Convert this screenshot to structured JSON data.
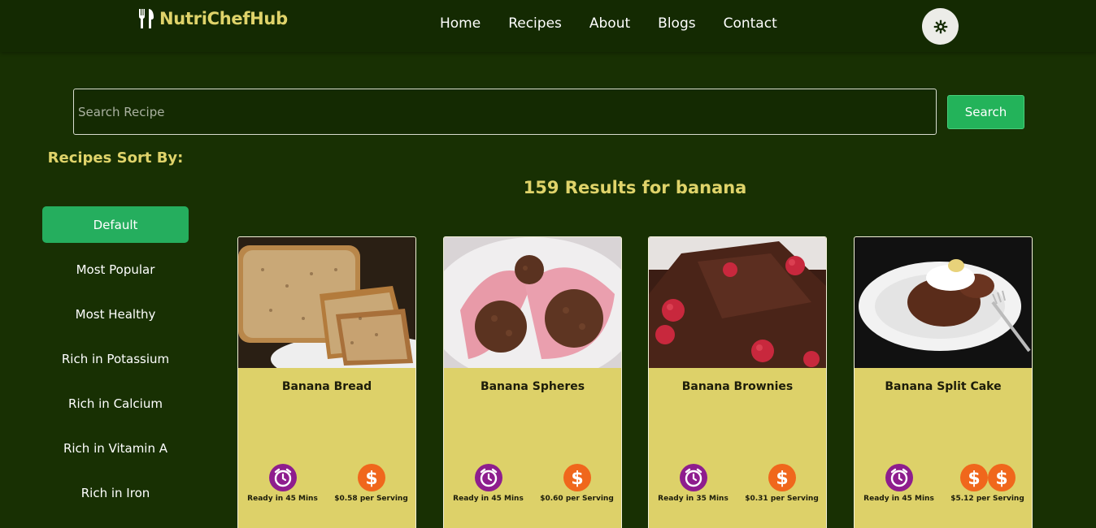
{
  "brand": {
    "name": "NutriChefHub",
    "color": "#dfd36a"
  },
  "nav": {
    "items": [
      "Home",
      "Recipes",
      "About",
      "Blogs",
      "Contact"
    ]
  },
  "theme_toggle": {
    "icon": "gear-icon"
  },
  "search": {
    "placeholder": "Search Recipe",
    "value": "",
    "button_label": "Search"
  },
  "sidebar": {
    "title": "Recipes Sort By:",
    "items": [
      "Default",
      "Most Popular",
      "Most Healthy",
      "Rich in Potassium",
      "Rich in Calcium",
      "Rich in Vitamin A",
      "Rich in Iron"
    ],
    "active": "Default"
  },
  "results": {
    "heading": "159 Results for banana",
    "cards": [
      {
        "title": "Banana Bread",
        "time": "Ready in 45 Mins",
        "price": "$0.58 per Serving",
        "price_icons": 1
      },
      {
        "title": "Banana Spheres",
        "time": "Ready in 45 Mins",
        "price": "$0.60 per Serving",
        "price_icons": 1
      },
      {
        "title": "Banana Brownies",
        "time": "Ready in 35 Mins",
        "price": "$0.31 per Serving",
        "price_icons": 1
      },
      {
        "title": "Banana Split Cake",
        "time": "Ready in 45 Mins",
        "price": "$5.12 per Serving",
        "price_icons": 2
      }
    ]
  },
  "colors": {
    "background": "#183003",
    "accent_green": "#25ae5e",
    "card": "#ddd169",
    "clock": "#8e1d8e",
    "dollar": "#f0671c"
  }
}
